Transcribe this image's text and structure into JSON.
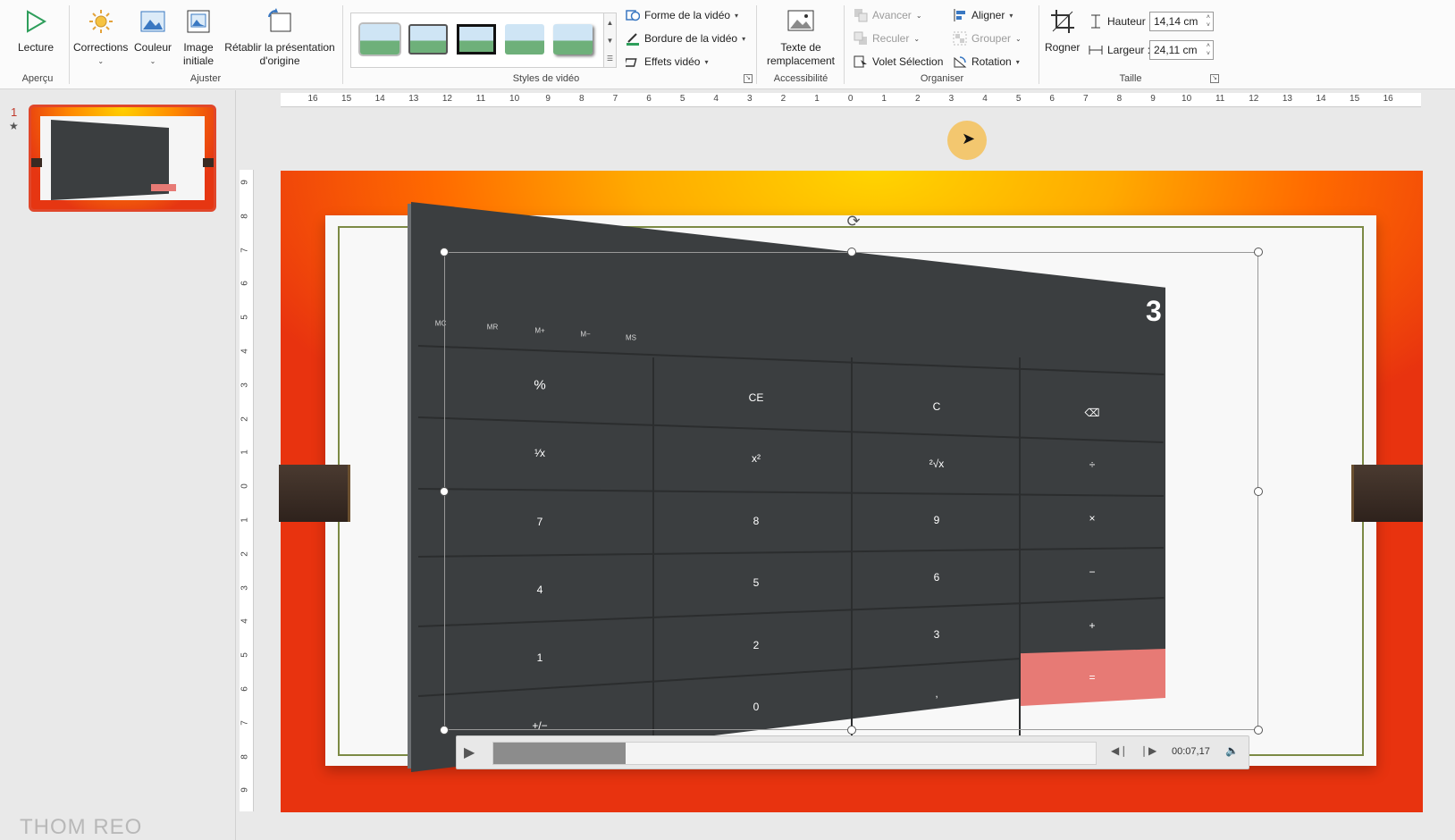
{
  "ribbon": {
    "apercu": {
      "label": "Lecture",
      "group": "Aperçu"
    },
    "ajuster": {
      "group": "Ajuster",
      "corrections": "Corrections",
      "couleur": "Couleur",
      "image_initiale_1": "Image",
      "image_initiale_2": "initiale",
      "retablir_1": "Rétablir la présentation",
      "retablir_2": "d'origine"
    },
    "styles_video": {
      "group": "Styles de vidéo",
      "forme": "Forme de la vidéo",
      "bordure": "Bordure de la vidéo",
      "effets": "Effets vidéo"
    },
    "accessibilite": {
      "group": "Accessibilité",
      "texte_1": "Texte de",
      "texte_2": "remplacement"
    },
    "organiser": {
      "group": "Organiser",
      "avancer": "Avancer",
      "reculer": "Reculer",
      "volet": "Volet Sélection",
      "aligner": "Aligner",
      "grouper": "Grouper",
      "rotation": "Rotation"
    },
    "taille": {
      "group": "Taille",
      "rogner": "Rogner",
      "hauteur_label": "Hauteur :",
      "hauteur_value": "14,14 cm",
      "largeur_label": "Largeur :",
      "largeur_value": "24,11 cm"
    }
  },
  "thumbnails": {
    "slide_number": "1",
    "star": "★"
  },
  "watermark": "THOM REO",
  "calculator": {
    "display": "3",
    "memory": [
      "MC",
      "MR",
      "M+",
      "M−",
      "MS"
    ],
    "keys": [
      "%",
      "CE",
      "C",
      "⌫",
      "¹⁄x",
      "x²",
      "²√x",
      "÷",
      "7",
      "8",
      "9",
      "×",
      "4",
      "5",
      "6",
      "−",
      "1",
      "2",
      "3",
      "+",
      "+/−",
      "0",
      ",",
      "="
    ]
  },
  "player": {
    "timecode": "00:07,17",
    "progress": 0.22
  },
  "rulers": {
    "h_ticks": [
      "16",
      "15",
      "14",
      "13",
      "12",
      "11",
      "10",
      "9",
      "8",
      "7",
      "6",
      "5",
      "4",
      "3",
      "2",
      "1",
      "0",
      "1",
      "2",
      "3",
      "4",
      "5",
      "6",
      "7",
      "8",
      "9",
      "10",
      "11",
      "12",
      "13",
      "14",
      "15",
      "16"
    ],
    "v_ticks": [
      "9",
      "8",
      "7",
      "6",
      "5",
      "4",
      "3",
      "2",
      "1",
      "0",
      "1",
      "2",
      "3",
      "4",
      "5",
      "6",
      "7",
      "8",
      "9"
    ]
  }
}
